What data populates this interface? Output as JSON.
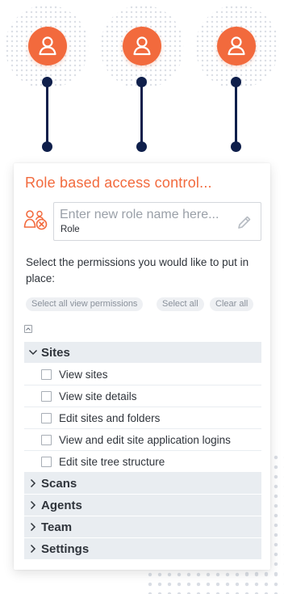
{
  "icons": {
    "avatar": "user-icon",
    "role": "role-access-icon",
    "edit": "pencil-icon",
    "collapse": "collapse-icon",
    "expanded": "chevron-down-icon",
    "collapsed": "chevron-right-icon"
  },
  "colors": {
    "accent": "#f26a3d",
    "connector": "#0f1f4b",
    "section_bg": "#e9edf1",
    "chip_bg": "#eef0f3"
  },
  "card": {
    "title": "Role based access control...",
    "role_input": {
      "placeholder": "Enter new role name here...",
      "value": "",
      "caption": "Role"
    },
    "instructions": "Select the permissions you would like to put in place:",
    "actions": {
      "select_all_view": "Select all view permissions",
      "select_all": "Select all",
      "clear_all": "Clear all"
    }
  },
  "sections": [
    {
      "label": "Sites",
      "expanded": true,
      "items": [
        {
          "label": "View sites",
          "checked": false
        },
        {
          "label": "View site details",
          "checked": false
        },
        {
          "label": "Edit sites and folders",
          "checked": false
        },
        {
          "label": "View and edit site application logins",
          "checked": false
        },
        {
          "label": "Edit site tree structure",
          "checked": false
        }
      ]
    },
    {
      "label": "Scans",
      "expanded": false
    },
    {
      "label": "Agents",
      "expanded": false
    },
    {
      "label": "Team",
      "expanded": false
    },
    {
      "label": "Settings",
      "expanded": false
    }
  ]
}
